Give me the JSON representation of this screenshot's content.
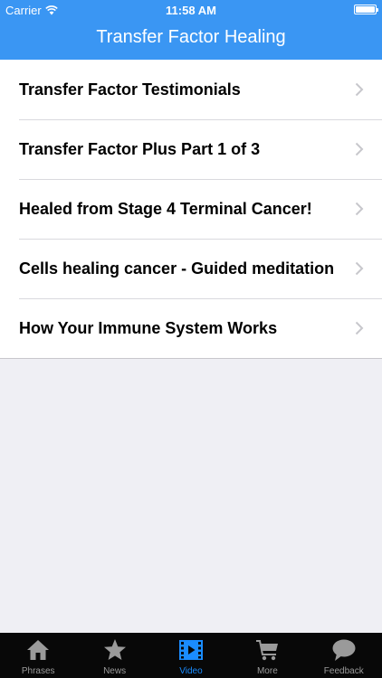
{
  "status_bar": {
    "carrier": "Carrier",
    "time": "11:58 AM"
  },
  "nav": {
    "title": "Transfer Factor Healing"
  },
  "list": {
    "items": [
      {
        "label": "Transfer Factor Testimonials"
      },
      {
        "label": "Transfer Factor Plus Part 1 of 3"
      },
      {
        "label": "Healed from Stage 4 Terminal Cancer!"
      },
      {
        "label": "Cells healing cancer - Guided meditation"
      },
      {
        "label": "How Your Immune System Works"
      }
    ]
  },
  "tabbar": {
    "tabs": [
      {
        "label": "Phrases",
        "icon": "house-icon"
      },
      {
        "label": "News",
        "icon": "star-icon"
      },
      {
        "label": "Video",
        "icon": "film-icon"
      },
      {
        "label": "More",
        "icon": "cart-icon"
      },
      {
        "label": "Feedback",
        "icon": "speech-bubble-icon"
      }
    ],
    "active_tab": "Video"
  },
  "colors": {
    "nav_bar": "#3a96f3",
    "active_tab": "#1a8cff",
    "tab_bar": "#080808",
    "background": "#efeff4"
  }
}
